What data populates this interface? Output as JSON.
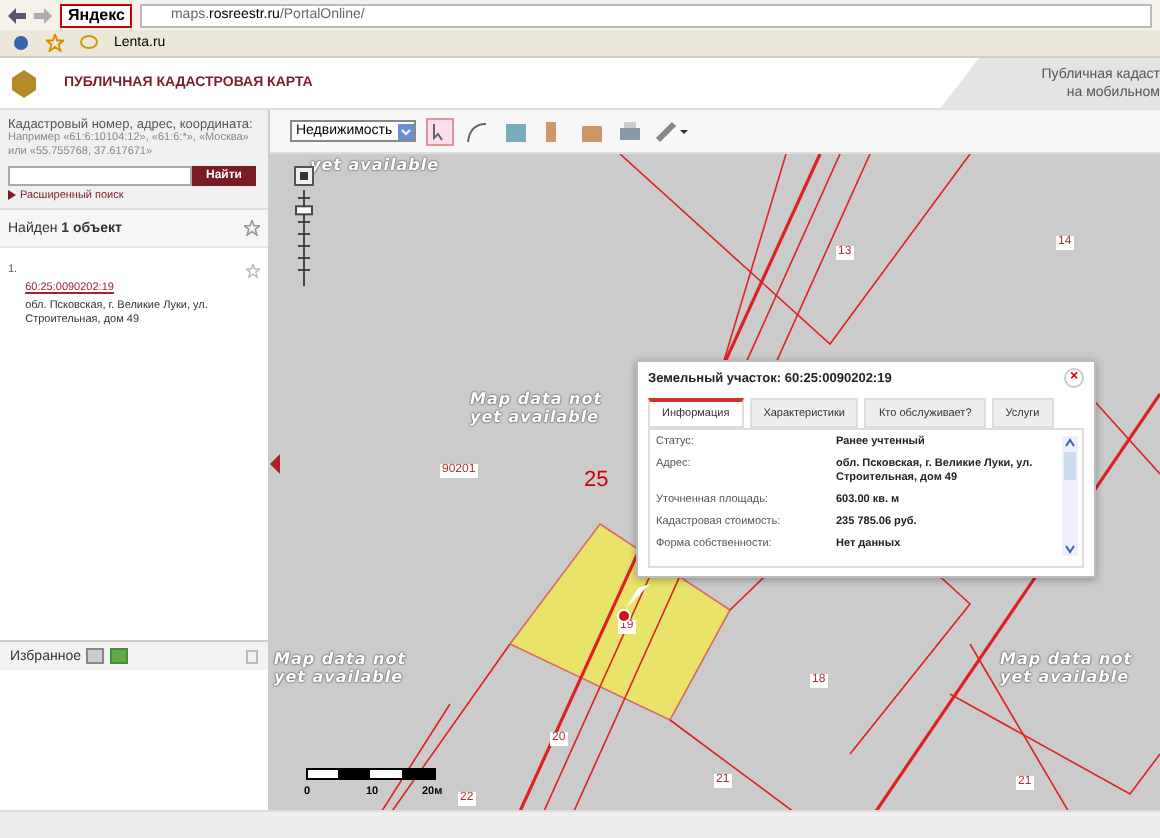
{
  "browser": {
    "search_engine": "Яндекс",
    "url": "maps.**rosreestr.ru**/PortalOnline/",
    "bookmarks": [
      {
        "label": "Lenta.ru"
      }
    ]
  },
  "header": {
    "title": "ПУБЛИЧНАЯ КАДАСТРОВАЯ КАРТА",
    "promo": [
      "Публичная кадаст",
      "на мобильном"
    ]
  },
  "search": {
    "label": "Кадастровый номер, адрес, координата:",
    "hint": "Например «61:6:10104:12», «61:6:*», «Москва» или «55.755768, 37.617671»",
    "button": "Найти",
    "advanced": "Расширенный поиск"
  },
  "results": {
    "heading": "Найден **1 объект**",
    "items": [
      {
        "number": "1.",
        "cadastral_number": "60:25:0090202:19",
        "address": "обл. Псковская, г. Великие Луки, ул. Строительная, дом 49"
      }
    ]
  },
  "favorites": {
    "label": "Избранное"
  },
  "toolbar": {
    "layer_select": "Недвижимость"
  },
  "map": {
    "notices": [
      "yet available",
      "Map data not\nyet available",
      "Map data not\nyet available",
      "Map data not\nyet available"
    ],
    "zoom": {
      "level": 0.83
    },
    "labels": [
      "13",
      "14",
      "90201",
      "25",
      "19",
      "20",
      "22",
      "18",
      "21",
      "21"
    ],
    "scale_labels": [
      "0",
      "10",
      "20м"
    ]
  },
  "popup": {
    "title": "Земельный участок: 60:25:0090202:19",
    "close": "×",
    "tabs": [
      {
        "label": "Информация",
        "selected": true
      },
      {
        "label": "Характеристики",
        "selected": false
      },
      {
        "label": "Кто обслуживает?",
        "selected": false
      },
      {
        "label": "Услуги",
        "selected": false
      }
    ],
    "rows": [
      {
        "label": "Статус:",
        "value": "Ранее учтенный"
      },
      {
        "label": "Адрес:",
        "value": "обл. Псковская, г. Великие Луки, ул. Строительная, дом 49"
      },
      {
        "label": "Уточненная площадь:",
        "value": "603.00 кв. м"
      },
      {
        "label": "Кадастровая стоимость:",
        "value": "235 785.06 руб."
      },
      {
        "label": "Форма собственности:",
        "value": "Нет данных"
      }
    ]
  }
}
